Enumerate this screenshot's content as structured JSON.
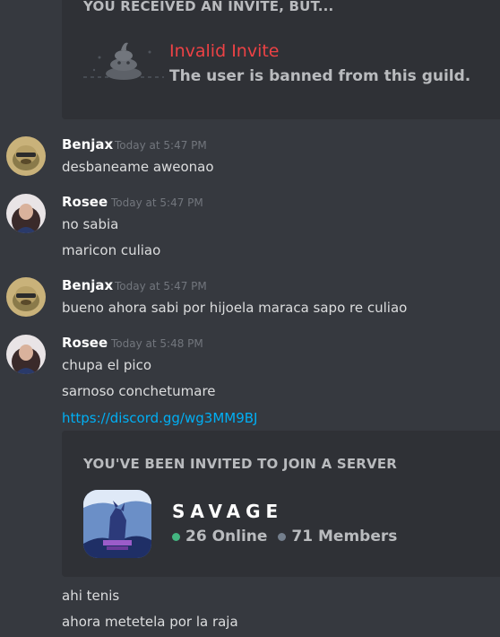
{
  "invalid_embed": {
    "header": "YOU RECEIVED AN INVITE, BUT...",
    "title": "Invalid Invite",
    "subtitle": "The user is banned from this guild.",
    "icon": "poop-icon"
  },
  "messages": [
    {
      "author": "Benjax",
      "timestamp": "Today at 5:47 PM",
      "lines": [
        "desbaneame aweonao"
      ]
    },
    {
      "author": "Rosee",
      "timestamp": "Today at 5:47 PM",
      "lines": [
        "no sabia",
        "maricon culiao"
      ]
    },
    {
      "author": "Benjax",
      "timestamp": "Today at 5:47 PM",
      "lines": [
        "bueno ahora sabi por hijoela maraca sapo re culiao"
      ]
    },
    {
      "author": "Rosee",
      "timestamp": "Today at 5:48 PM",
      "lines": [
        "chupa el pico",
        "sarnoso conchetumare"
      ],
      "link": "https://discord.gg/wg3MM9BJ"
    }
  ],
  "invite_embed": {
    "header": "YOU'VE BEEN INVITED TO JOIN A SERVER",
    "server_name": "SAVAGE",
    "online": "26 Online",
    "members": "71 Members",
    "online_color": "#43b581",
    "members_color": "#747f8d"
  },
  "trailing_lines": [
    "ahi tenis",
    "ahora metetela por la raja"
  ],
  "colors": {
    "background": "#36393f",
    "embed_background": "#2f3136",
    "invalid_red": "#ed4245",
    "link_blue": "#00aff4"
  }
}
